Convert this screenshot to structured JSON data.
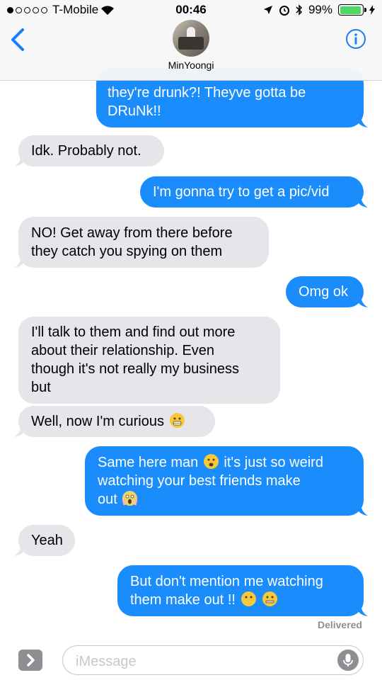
{
  "status_bar": {
    "carrier": "T-Mobile",
    "time": "00:46",
    "battery": "99%"
  },
  "header": {
    "contact_name": "MinYoongi"
  },
  "messages": [
    {
      "from": "me",
      "lines": [
        "they're drunk?! Theyve gotta be",
        "DRuNk!!"
      ]
    },
    {
      "from": "them",
      "lines": [
        "Idk. Probably not."
      ]
    },
    {
      "from": "me",
      "lines": [
        "I'm gonna try to get a pic/vid"
      ]
    },
    {
      "from": "them",
      "lines": [
        "NO! Get away from there before",
        "they catch you spying on them"
      ]
    },
    {
      "from": "me",
      "lines": [
        "Omg ok"
      ]
    },
    {
      "from": "them",
      "lines": [
        "I'll talk to them and find out more",
        "about their relationship. Even",
        "though it's not really my business",
        "but"
      ]
    },
    {
      "from": "them",
      "lines": [
        "Well, now I'm curious"
      ]
    },
    {
      "from": "me",
      "lines": [
        "Same here man",
        "it's just so weird",
        "watching your best friends make",
        "out"
      ]
    },
    {
      "from": "them",
      "lines": [
        "Yeah"
      ]
    },
    {
      "from": "me",
      "lines": [
        "But don't mention me watching",
        "them make out !!"
      ]
    }
  ],
  "emoji": {
    "grimacing": "grimacing-face",
    "frowning": "frowning-face",
    "scream": "face-screaming",
    "hushed": "hushed-face",
    "zipper": "zipper-mouth-face"
  },
  "delivered_label": "Delivered",
  "input": {
    "placeholder": "iMessage"
  },
  "colors": {
    "outgoing": "#1a8cfb",
    "incoming": "#e5e5ea",
    "accent": "#147efb"
  }
}
